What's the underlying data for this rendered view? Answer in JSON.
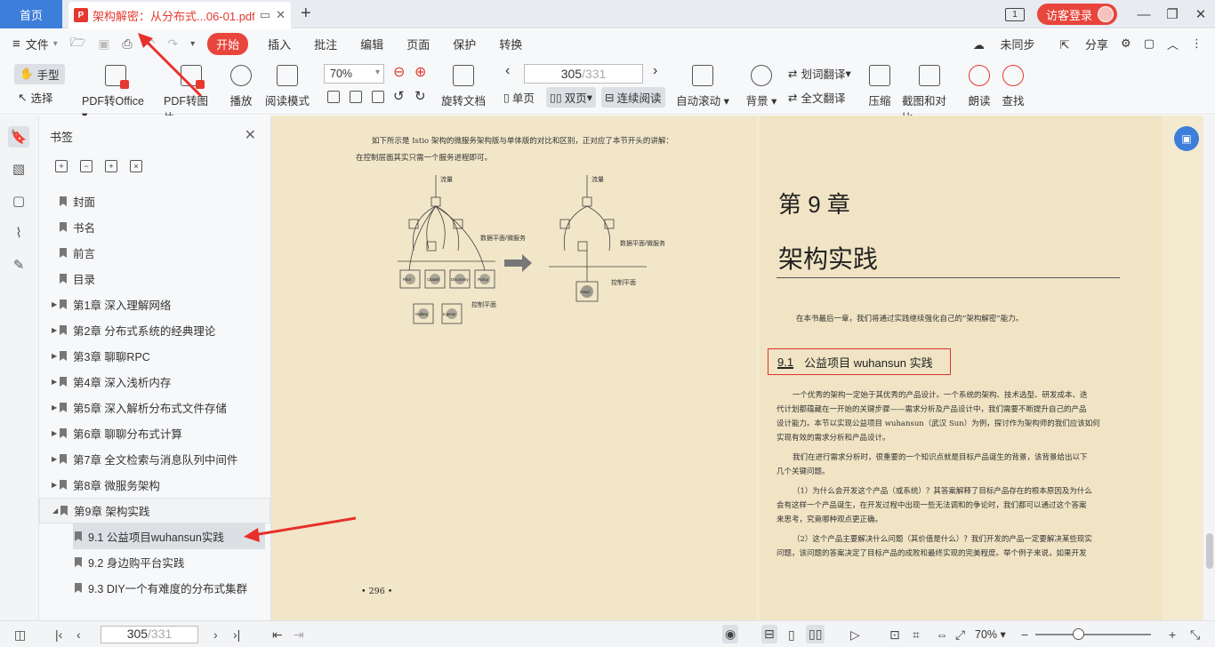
{
  "titlebar": {
    "home_tab": "首页",
    "doc_tab": "架构解密：从分布式...06-01.pdf",
    "login": "访客登录"
  },
  "menubar": {
    "file": "文件",
    "tabs": [
      "开始",
      "插入",
      "批注",
      "编辑",
      "页面",
      "保护",
      "转换"
    ],
    "sync": "未同步",
    "share": "分享"
  },
  "ribbon": {
    "hand": "手型",
    "select": "选择",
    "pdf_to_office": "PDF转Office",
    "pdf_to_image": "PDF转图片",
    "play": "播放",
    "read_mode": "阅读模式",
    "zoom": "70%",
    "rotate": "旋转文档",
    "page_current": "305",
    "page_total": "/331",
    "single": "单页",
    "double": "双页",
    "continuous": "连续阅读",
    "auto_scroll": "自动滚动",
    "background": "背景",
    "word_translate": "划词翻译",
    "full_translate": "全文翻译",
    "compress": "压缩",
    "screenshot_compare": "截图和对比",
    "read_aloud": "朗读",
    "find": "查找"
  },
  "bookmarks": {
    "title": "书签",
    "items": [
      {
        "label": "封面",
        "level": 1,
        "expandable": false
      },
      {
        "label": "书名",
        "level": 1,
        "expandable": false
      },
      {
        "label": "前言",
        "level": 1,
        "expandable": false
      },
      {
        "label": "目录",
        "level": 1,
        "expandable": false
      },
      {
        "label": "第1章  深入理解网络",
        "level": 1,
        "expandable": true
      },
      {
        "label": "第2章  分布式系统的经典理论",
        "level": 1,
        "expandable": true
      },
      {
        "label": "第3章  聊聊RPC",
        "level": 1,
        "expandable": true
      },
      {
        "label": "第4章  深入浅析内存",
        "level": 1,
        "expandable": true
      },
      {
        "label": "第5章  深入解析分布式文件存储",
        "level": 1,
        "expandable": true
      },
      {
        "label": "第6章  聊聊分布式计算",
        "level": 1,
        "expandable": true
      },
      {
        "label": "第7章  全文检索与消息队列中间件",
        "level": 1,
        "expandable": true
      },
      {
        "label": "第8章  微服务架构",
        "level": 1,
        "expandable": true
      },
      {
        "label": "第9章  架构实践",
        "level": 1,
        "expandable": true,
        "open": true
      },
      {
        "label": "9.1  公益项目wuhansun实践",
        "level": 2,
        "selected": true
      },
      {
        "label": "9.2  身边购平台实践",
        "level": 2
      },
      {
        "label": "9.3  DIY一个有难度的分布式集群",
        "level": 2
      }
    ]
  },
  "document": {
    "left_intro": "如下所示是 Istio 架构的微服务架构版与单体版的对比和区别，正对应了本节开头的讲解：在控制层面其实只需一个服务进程即可。",
    "left_intro_1": "如下所示是 Istio 架构的微服务架构版与单体版的对比和区别，正对应了本节开头的讲解：",
    "left_intro_2": "在控制层面其实只需一个服务进程即可。",
    "diagram": {
      "traffic": "流量",
      "data_plane": "数据平面/微服务",
      "control_plane": "控制平面",
      "nodes_left": [
        "Pilot",
        "Citadel",
        "Discovery",
        "Policy",
        "Gallery",
        "Injector"
      ],
      "node_right": "Istiod"
    },
    "page_left_num": "• 296 •",
    "chapter": "第 9 章",
    "chapter_title": "架构实践",
    "chapter_intro": "在本书最后一章，我们将通过实践继续强化自己的“架构解密”能力。",
    "section_num": "9.1",
    "section_title": "公益项目 wuhansun 实践",
    "paragraphs": [
      "一个优秀的架构一定始于其优秀的产品设计。一个系统的架构、技术选型、研发成本、迭",
      "代计划都蕴藏在一开始的关键步骤——需求分析及产品设计中，我们需要不断提升自己的产品",
      "设计能力。本节以实现公益项目 wuhansun（武汉 Sun）为例，探讨作为架构师的我们应该如何",
      "实现有效的需求分析和产品设计。",
      "我们在进行需求分析时，很重要的一个知识点就是目标产品诞生的背景，该背景给出以下",
      "几个关键问题。",
      "（1）为什么会开发这个产品（或系统）？其答案解释了目标产品存在的根本原因及为什么",
      "会有这样一个产品诞生，在开发过程中出现一些无法调和的争论时，我们都可以通过这个答案",
      "来思考，究竟哪种观点更正确。",
      "（2）这个产品主要解决什么问题（其价值是什么）？我们开发的产品一定要解决某些现实",
      "问题，该问题的答案决定了目标产品的成败和最终实现的完美程度。举个例子来说，如果开发"
    ]
  },
  "statusbar": {
    "page_current": "305",
    "page_total": "/331",
    "zoom": "70%"
  }
}
